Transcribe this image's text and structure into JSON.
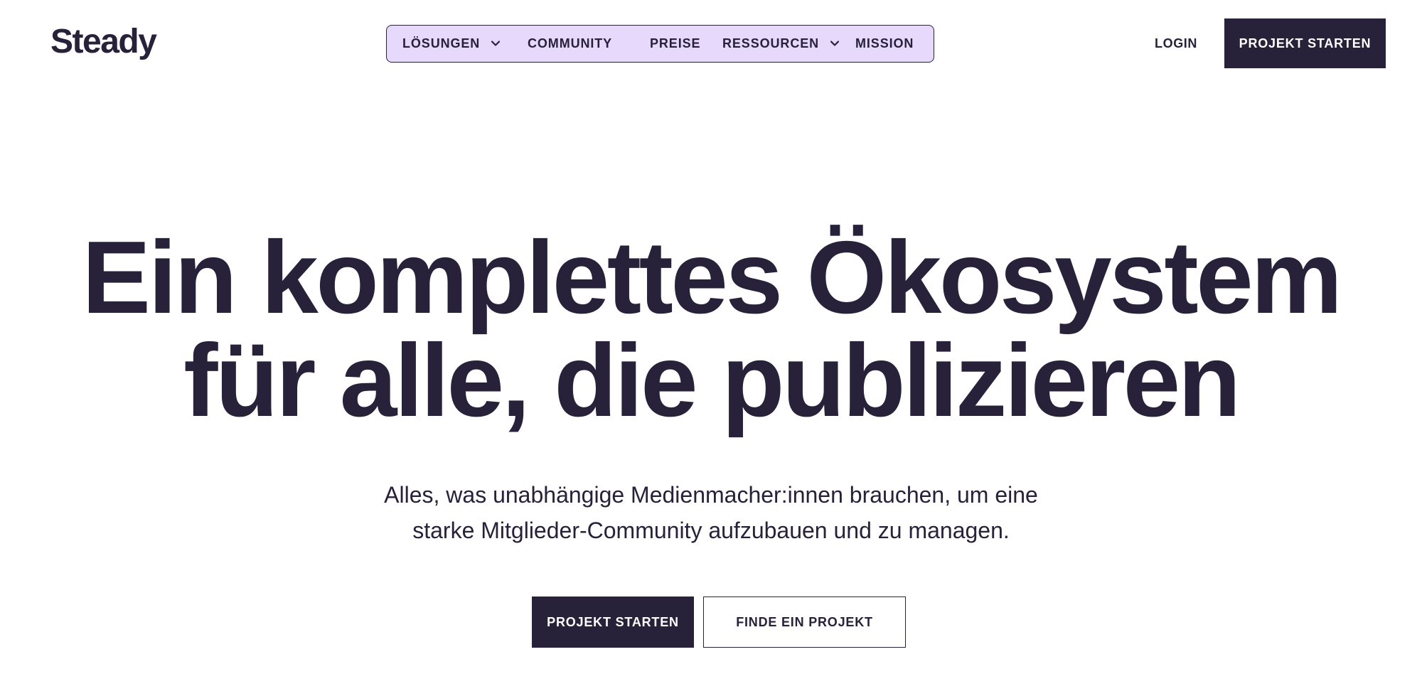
{
  "brand": {
    "logo_text": "Steady"
  },
  "nav": {
    "items": [
      {
        "label": "LÖSUNGEN",
        "has_dropdown": true
      },
      {
        "label": "COMMUNITY",
        "has_dropdown": false
      },
      {
        "label": "PREISE",
        "has_dropdown": false
      },
      {
        "label": "RESSOURCEN",
        "has_dropdown": true
      },
      {
        "label": "MISSION",
        "has_dropdown": false
      }
    ],
    "pill_color": "#e7d9fc"
  },
  "header": {
    "login_label": "LOGIN",
    "cta_label": "PROJEKT STARTEN"
  },
  "hero": {
    "headline_line1": "Ein komplettes Ökosystem",
    "headline_line2": "für alle, die publizieren",
    "subline_line1": "Alles, was unabhängige Medienmacher:innen brauchen, um eine",
    "subline_line2": "starke Mitglieder-Community aufzubauen und zu managen.",
    "primary_button": "PROJEKT STARTEN",
    "secondary_button": "FINDE EIN PROJEKT"
  },
  "colors": {
    "primary": "#27213a",
    "background": "#ffffff",
    "accent": "#e7d9fc"
  }
}
